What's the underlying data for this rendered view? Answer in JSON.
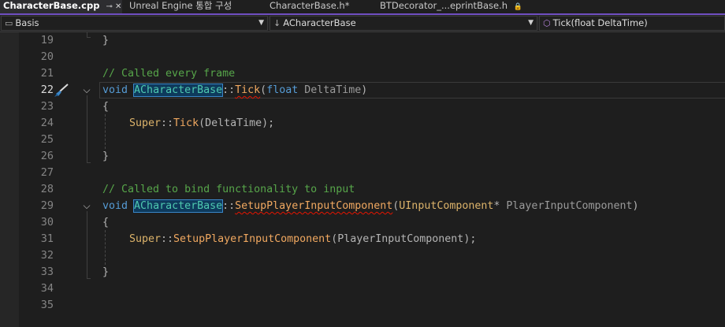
{
  "tabs": [
    {
      "label": "CharacterBase.cpp",
      "active": true,
      "suffix": "⊸ ✕"
    },
    {
      "label": "Unreal Engine 통합 구성",
      "active": false,
      "suffix": ""
    },
    {
      "label": "CharacterBase.h*",
      "active": false,
      "suffix": ""
    },
    {
      "label": "BTDecorator_...eprintBase.h",
      "active": false,
      "suffix": "🔒"
    }
  ],
  "navigation": {
    "project": "Basis",
    "scope": "ACharacterBase",
    "member": "Tick(float DeltaTime)"
  },
  "line_numbers": [
    "19",
    "20",
    "21",
    "22",
    "23",
    "24",
    "25",
    "26",
    "27",
    "28",
    "29",
    "30",
    "31",
    "32",
    "33",
    "34",
    "35"
  ],
  "current_line": "22",
  "code": {
    "l19": "}",
    "comment1": "// Called every frame",
    "void": "void",
    "class_name": "ACharacterBase",
    "scope_op": "::",
    "tick": "Tick",
    "lparen": "(",
    "float": "float",
    "delta_param": " DeltaTime",
    "rparen": ")",
    "open_brace": "{",
    "close_brace": "}",
    "super": "Super",
    "delta_arg": "DeltaTime",
    "call_end": ");",
    "comment2": "// Called to bind functionality to input",
    "setup": "SetupPlayerInputComponent",
    "input_type": "UInputComponent",
    "ptr": "*",
    "input_param": " PlayerInputComponent",
    "input_arg": "PlayerInputComponent"
  },
  "colors": {
    "keyword": "#569cd6",
    "comment": "#57a64a",
    "accent_tab": "#8b5cf6",
    "function": "#f0a860",
    "class": "#dcb36a"
  }
}
